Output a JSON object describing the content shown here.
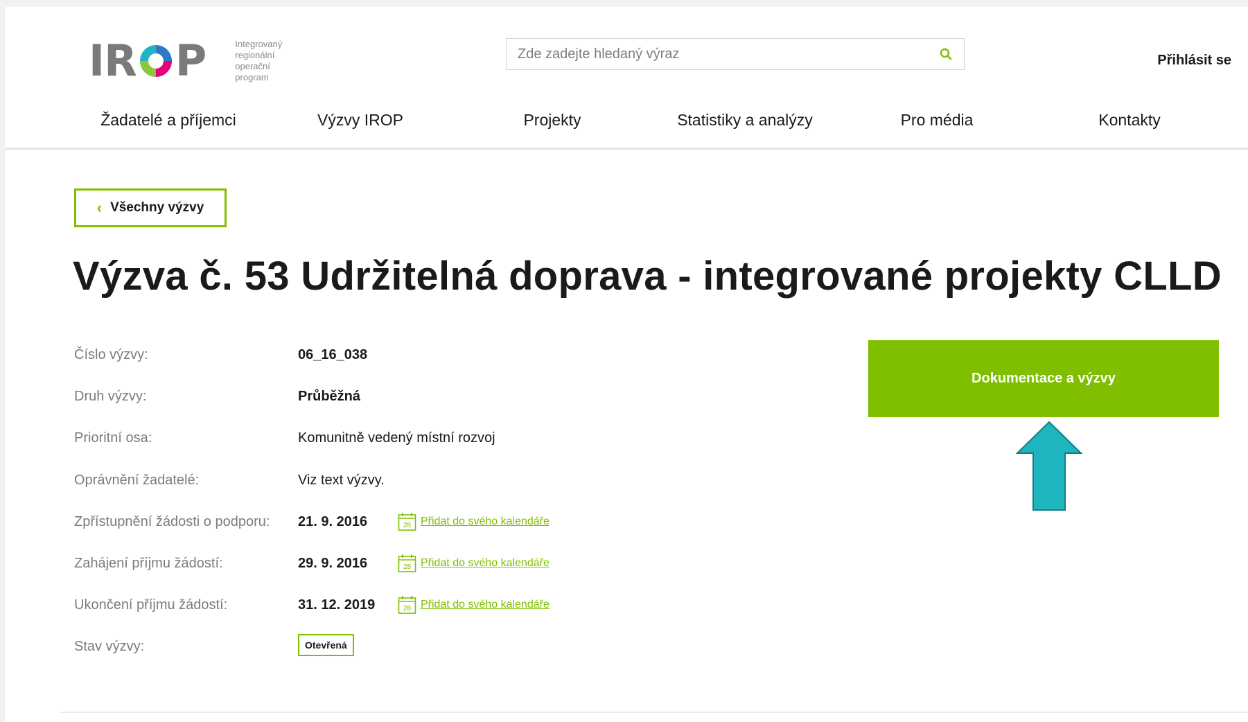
{
  "header": {
    "logo_text": "IROP",
    "logo_subtitle": [
      "Integrovaný",
      "regionální",
      "operační",
      "program"
    ],
    "search_placeholder": "Zde zadejte hledaný výraz",
    "login_label": "Přihlásit se"
  },
  "nav": {
    "items": [
      "Žadatelé a příjemci",
      "Výzvy IROP",
      "Projekty",
      "Statistiky a analýzy",
      "Pro média",
      "Kontakty"
    ]
  },
  "back_button": {
    "label": "Všechny výzvy"
  },
  "page_title": "Výzva č. 53 Udržitelná doprava - integrované projekty CLLD",
  "details": {
    "rows": [
      {
        "label": "Číslo výzvy:",
        "value": "06_16_038"
      },
      {
        "label": "Druh výzvy:",
        "value": "Průběžná"
      },
      {
        "label": "Prioritní osa:",
        "value": "Komunitně vedený místní rozvoj"
      },
      {
        "label": "Oprávnění žadatelé:",
        "value": "Viz text výzvy."
      },
      {
        "label": "Zpřístupnění žádosti o podporu:",
        "value": "21. 9. 2016",
        "calendar_link": "Přidat do svého kalendáře"
      },
      {
        "label": "Zahájení příjmu žádostí:",
        "value": "29. 9. 2016",
        "calendar_link": "Přidat do svého kalendáře"
      },
      {
        "label": "Ukončení příjmu žádostí:",
        "value": "31. 12. 2019",
        "calendar_link": "Přidat do svého kalendáře"
      },
      {
        "label": "Stav výzvy:",
        "badge": "Otevřená"
      }
    ],
    "calendar_day": "28"
  },
  "documentation_button": {
    "label": "Dokumentace a výzvy"
  },
  "colors": {
    "accent_green": "#7fbf00",
    "arrow_teal": "#1fb5bf",
    "label_gray": "#7c7c7c"
  },
  "icons": {
    "search": "search-icon",
    "back": "chevron-left-icon",
    "calendar": "calendar-icon",
    "annotation": "arrow-up-icon"
  }
}
